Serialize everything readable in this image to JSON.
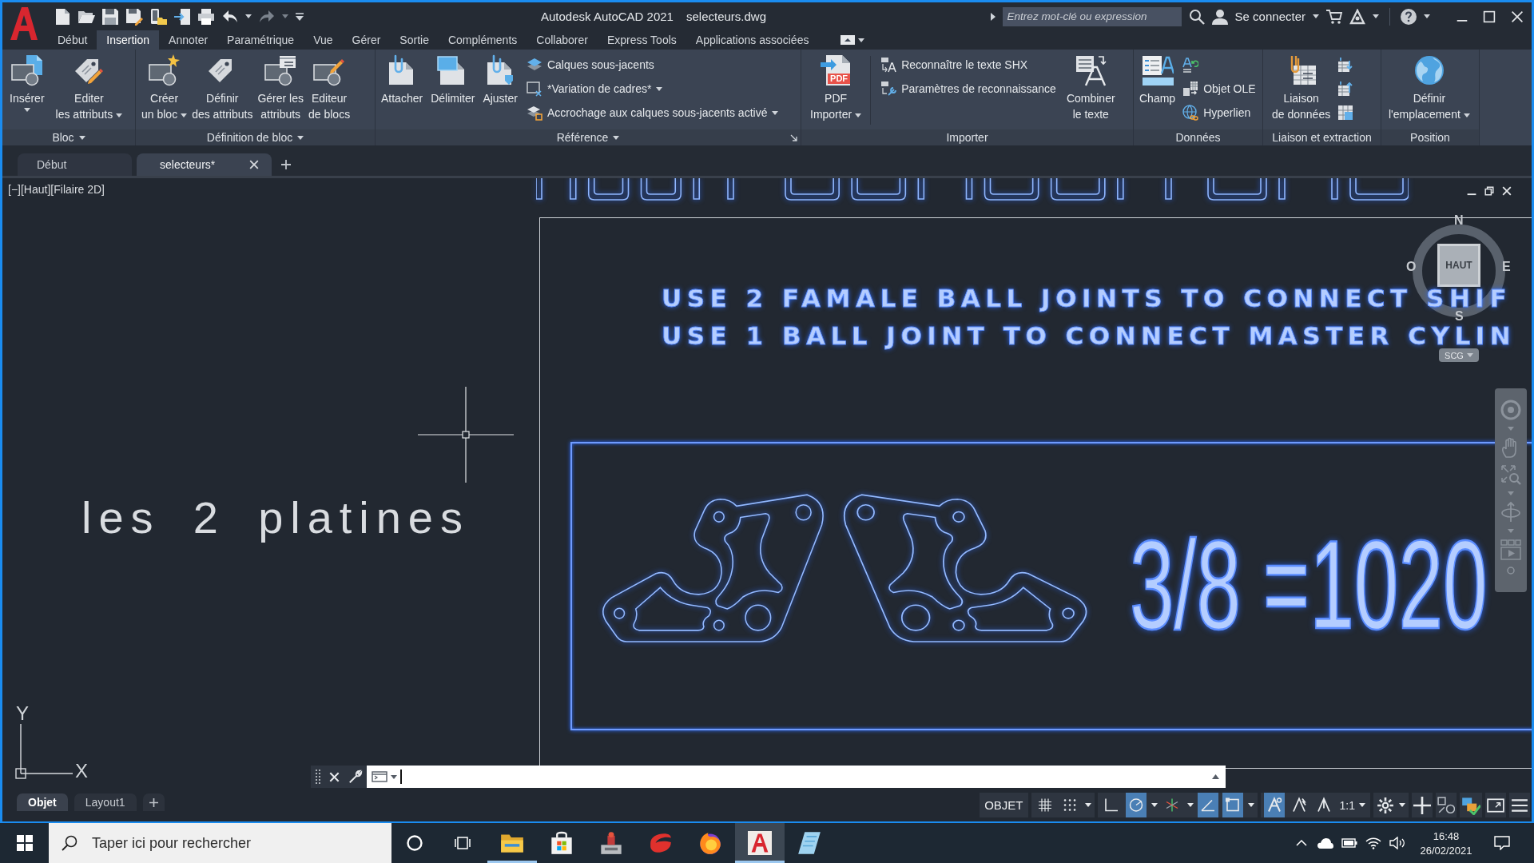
{
  "window": {
    "title": "Autodesk AutoCAD 2021",
    "document": "selecteurs.dwg"
  },
  "header_search": {
    "placeholder": "Entrez mot-clé ou expression"
  },
  "account": {
    "label": "Se connecter"
  },
  "menu_tabs": [
    {
      "label": "Début",
      "selected": false
    },
    {
      "label": "Insertion",
      "selected": true
    },
    {
      "label": "Annoter",
      "selected": false
    },
    {
      "label": "Paramétrique",
      "selected": false
    },
    {
      "label": "Vue",
      "selected": false
    },
    {
      "label": "Gérer",
      "selected": false
    },
    {
      "label": "Sortie",
      "selected": false
    },
    {
      "label": "Compléments",
      "selected": false
    },
    {
      "label": "Collaborer",
      "selected": false
    },
    {
      "label": "Express Tools",
      "selected": false
    },
    {
      "label": "Applications associées",
      "selected": false
    }
  ],
  "ribbon_panels": [
    {
      "title": "Bloc",
      "menu": true,
      "launcher": false,
      "items": [
        {
          "kind": "large",
          "label": "Insérer",
          "dropdown": true
        },
        {
          "kind": "large",
          "label": "Editer\nles attributs",
          "dropdown": true
        }
      ]
    },
    {
      "title": "Définition de bloc",
      "menu": true,
      "launcher": false,
      "items": [
        {
          "kind": "large",
          "label": "Créer\nun bloc",
          "dropdown": true
        },
        {
          "kind": "large",
          "label": "Définir\ndes attributs",
          "dropdown": false
        },
        {
          "kind": "large",
          "label": "Gérer les\nattributs",
          "dropdown": false
        },
        {
          "kind": "large",
          "label": "Editeur\nde blocs",
          "dropdown": false
        }
      ]
    },
    {
      "title": "Référence",
      "menu": true,
      "launcher": true,
      "items": [
        {
          "kind": "large",
          "label": "Attacher",
          "dropdown": false
        },
        {
          "kind": "large",
          "label": "Délimiter",
          "dropdown": false
        },
        {
          "kind": "large",
          "label": "Ajuster",
          "dropdown": false
        },
        {
          "kind": "stack",
          "rows": [
            {
              "label": "Calques sous-jacents",
              "dropdown": false
            },
            {
              "label": "*Variation de cadres*",
              "dropdown": true
            },
            {
              "label": "Accrochage aux calques sous-jacents activé",
              "dropdown": true
            }
          ]
        }
      ]
    },
    {
      "title": "Importer",
      "menu": false,
      "launcher": false,
      "items": [
        {
          "kind": "large",
          "label": "PDF\nImporter",
          "badge": "PDF",
          "dropdown": true
        },
        {
          "kind": "stack",
          "rows": [
            {
              "label": "Reconnaître le texte SHX",
              "dropdown": false
            },
            {
              "label": "Paramètres de reconnaissance",
              "dropdown": false
            }
          ]
        },
        {
          "kind": "large",
          "label": "Combiner\nle texte",
          "dropdown": false
        }
      ]
    },
    {
      "title": "Données",
      "menu": false,
      "launcher": false,
      "items": [
        {
          "kind": "large",
          "label": "Champ",
          "dropdown": false
        },
        {
          "kind": "stack",
          "rows": [
            {
              "dropdown": false
            },
            {
              "label": "Objet OLE",
              "dropdown": false
            },
            {
              "label": "Hyperlien",
              "dropdown": false
            }
          ]
        }
      ]
    },
    {
      "title": "Liaison et extraction",
      "menu": false,
      "launcher": false,
      "items": [
        {
          "kind": "large",
          "label": "Liaison\nde données",
          "dropdown": false
        },
        {
          "kind": "stack",
          "rows": [
            {
              "dropdown": false
            },
            {
              "dropdown": false
            },
            {
              "dropdown": false
            }
          ]
        }
      ]
    },
    {
      "title": "Position",
      "menu": false,
      "launcher": false,
      "items": [
        {
          "kind": "large",
          "label": "Définir\nl'emplacement",
          "dropdown": true
        }
      ]
    }
  ],
  "document_tabs": [
    {
      "label": "Début",
      "selected": false
    },
    {
      "label": "selecteurs*",
      "selected": true
    }
  ],
  "viewport": {
    "controls": [
      "[−]",
      "[Haut]",
      "[Filaire 2D]"
    ],
    "notes": [
      "USE 2 FAMALE BALL JOINTS TO CONNECT SHIF",
      "USE 1 BALL JOINT TO CONNECT MASTER CYLIN"
    ],
    "caption": "les 2 platines",
    "ratio": "3/8 =1020"
  },
  "view_cube": {
    "face": "HAUT",
    "north": "N",
    "south": "S",
    "east": "E",
    "west": "O",
    "coordinate_system": "SCG"
  },
  "ucs_icon": {
    "y_axis": "Y",
    "x_axis": "X"
  },
  "layout_tabs": [
    {
      "label": "Objet",
      "selected": true
    },
    {
      "label": "Layout1",
      "selected": false
    }
  ],
  "status_bar": {
    "space": "OBJET",
    "toggles": [
      {
        "on": false,
        "dropdown": false
      },
      {
        "on": false,
        "dropdown": true
      },
      {
        "on": false,
        "dropdown": false
      },
      {
        "on": true,
        "dropdown": true
      },
      {
        "on": false,
        "dropdown": true
      },
      {
        "on": true,
        "dropdown": false
      },
      {
        "on": true,
        "dropdown": true
      },
      {
        "on": true,
        "dropdown": false
      },
      {
        "on": false,
        "dropdown": false
      },
      {
        "on": false,
        "dropdown": false
      }
    ],
    "scale": "1:1"
  },
  "taskbar": {
    "search": {
      "placeholder": "Taper ici pour rechercher"
    },
    "apps": [
      {
        "running": true,
        "active": false
      },
      {
        "running": false,
        "active": false
      },
      {
        "running": false,
        "active": false
      },
      {
        "running": false,
        "active": false
      },
      {
        "running": false,
        "active": false
      },
      {
        "running": true,
        "active": true
      },
      {
        "running": false,
        "active": false
      }
    ],
    "time": "16:48",
    "date": "26/02/2021"
  }
}
